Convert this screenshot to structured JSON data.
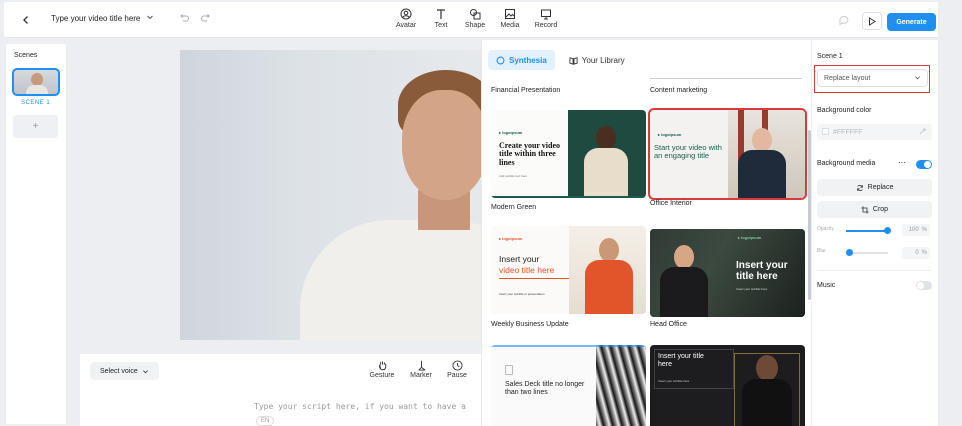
{
  "header": {
    "title": "Type your video title here",
    "tools": [
      {
        "label": "Avatar",
        "icon": "avatar-icon"
      },
      {
        "label": "Text",
        "icon": "text-icon"
      },
      {
        "label": "Shape",
        "icon": "shape-icon"
      },
      {
        "label": "Media",
        "icon": "media-icon"
      },
      {
        "label": "Record",
        "icon": "record-icon"
      }
    ],
    "generate_label": "Generate"
  },
  "scenes": {
    "label": "Scenes",
    "items": [
      {
        "name": "SCENE 1"
      }
    ],
    "add_label": "+"
  },
  "script": {
    "voice_label": "Select voice",
    "tools": [
      {
        "label": "Gesture",
        "icon": "gesture-icon"
      },
      {
        "label": "Marker",
        "icon": "marker-icon"
      },
      {
        "label": "Pause",
        "icon": "pause-icon"
      }
    ],
    "placeholder": "Type your script here, if you want to have a",
    "language": "EN"
  },
  "templates": {
    "tabs": [
      {
        "label": "Synthesia",
        "active": true
      },
      {
        "label": "Your Library",
        "active": false
      }
    ],
    "items": [
      {
        "name": "Financial Presentation",
        "texts": []
      },
      {
        "name": "Content marketing",
        "texts": []
      },
      {
        "name": "Modern Green",
        "texts": [
          "Create your video title within three lines",
          "Add subtitle text here"
        ]
      },
      {
        "name": "Office Interior",
        "texts": [
          "Start your video with an engaging title"
        ]
      },
      {
        "name": "Weekly Business Update",
        "texts": [
          "Insert your",
          "video title here",
          "Insert your subtitle or presentation"
        ]
      },
      {
        "name": "Head Office",
        "texts": [
          "Insert your title here",
          "Insert your subtitle here"
        ]
      },
      {
        "name": "",
        "texts": [
          "Sales Deck title no longer than two lines"
        ]
      },
      {
        "name": "",
        "texts": [
          "Insert your title here",
          "Insert your subtitle here"
        ]
      }
    ]
  },
  "properties": {
    "title": "Scene 1",
    "layout_label": "Replace layout",
    "background_color_label": "Background color",
    "background_color_value": "#FFFFFF",
    "background_media_label": "Background media",
    "replace_label": "Replace",
    "crop_label": "Crop",
    "opacity_label": "Opacity",
    "opacity_value": "100",
    "blur_label": "Blur",
    "blur_value": "0",
    "percent": "%",
    "music_label": "Music",
    "background_media_on": true,
    "music_on": false
  },
  "colors": {
    "accent": "#1f8ff2",
    "selection": "#d93b3b",
    "modern_green": "#1a5c4f",
    "weekly_orange": "#e2552b",
    "dark_card": "#1d1d1f"
  }
}
